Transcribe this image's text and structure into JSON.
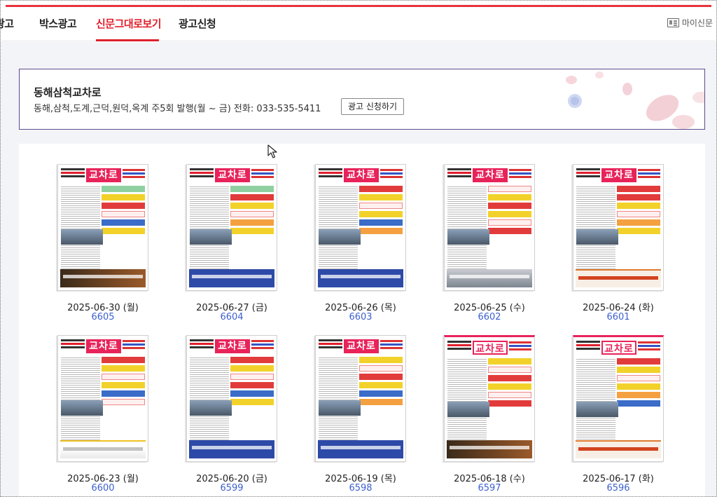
{
  "nav": {
    "items": [
      {
        "label": "광고"
      },
      {
        "label": "박스광고"
      },
      {
        "label": "신문그대로보기",
        "active": true
      },
      {
        "label": "광고신청"
      }
    ],
    "mypage_label": "마이신문"
  },
  "info": {
    "title": "동해삼척교차로",
    "description": "동해,삼척,도계,근덕,원덕,옥계 주5회 발행(월 ~ 금) 전화: 033-535-5411",
    "button_label": "광고 신청하기"
  },
  "papers": [
    {
      "date": "2025-06-30 (월)",
      "issue": "6605",
      "logo_text": "교차로"
    },
    {
      "date": "2025-06-27 (금)",
      "issue": "6604",
      "logo_text": "교차로"
    },
    {
      "date": "2025-06-26 (목)",
      "issue": "6603",
      "logo_text": "교차로"
    },
    {
      "date": "2025-06-25 (수)",
      "issue": "6602",
      "logo_text": "교차로"
    },
    {
      "date": "2025-06-24 (화)",
      "issue": "6601",
      "logo_text": "교차로"
    },
    {
      "date": "2025-06-23 (월)",
      "issue": "6600",
      "logo_text": "교차로"
    },
    {
      "date": "2025-06-20 (금)",
      "issue": "6599",
      "logo_text": "교차로"
    },
    {
      "date": "2025-06-19 (목)",
      "issue": "6598",
      "logo_text": "교차로"
    },
    {
      "date": "2025-06-18 (수)",
      "issue": "6597",
      "logo_text": "교차로"
    },
    {
      "date": "2025-06-17 (화)",
      "issue": "6596",
      "logo_text": "교차로"
    }
  ],
  "colors": {
    "accent": "#e0202c",
    "link": "#3c5fcf",
    "box_border": "#5d4a8c",
    "logo": "#e8235a"
  },
  "icons": {
    "mypage": "newspaper-icon",
    "cursor": "mouse-pointer-icon"
  }
}
